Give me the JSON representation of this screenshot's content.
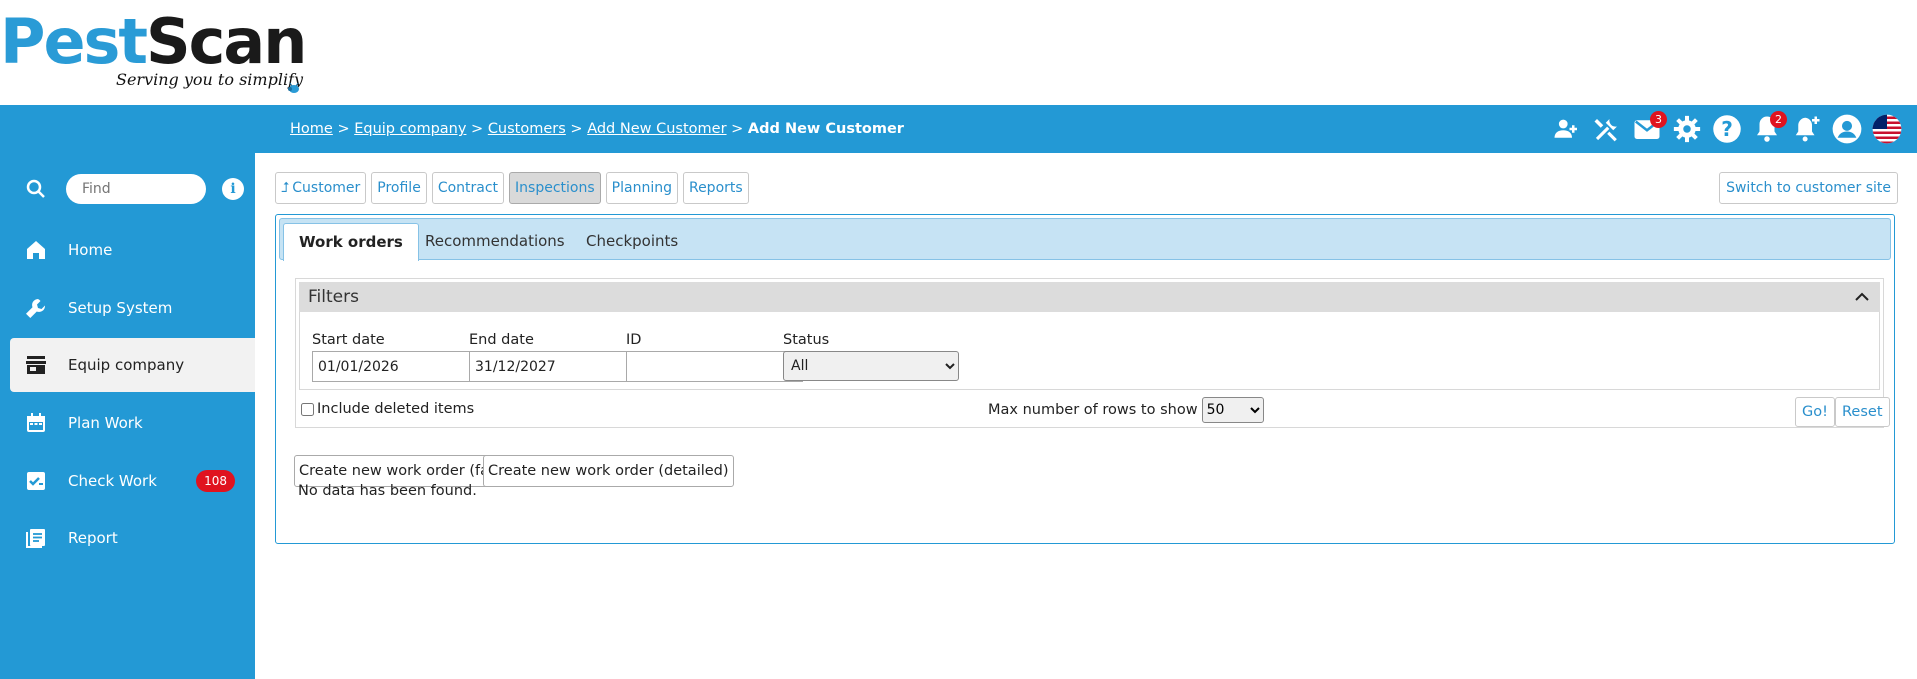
{
  "logo": {
    "pest": "Pest",
    "scan": "Scan",
    "tagline": "Serving you to simplify"
  },
  "breadcrumb": {
    "items": [
      "Home",
      "Equip company",
      "Customers",
      "Add New Customer"
    ],
    "separator": ">",
    "current": "Add New Customer"
  },
  "topbar": {
    "icons": [
      "users-icon",
      "tools-icon",
      "mail-icon",
      "gear-icon",
      "help-icon",
      "bell-icon",
      "bell-add-icon",
      "user-account-icon",
      "uk-flag-icon"
    ],
    "mail_badge": "3",
    "bell_badge": "2"
  },
  "sidebar": {
    "search_placeholder": "Find",
    "info_label": "i",
    "items": [
      {
        "label": "Home",
        "icon": "home-icon"
      },
      {
        "label": "Setup System",
        "icon": "wrench-icon"
      },
      {
        "label": "Equip company",
        "icon": "store-icon"
      },
      {
        "label": "Plan Work",
        "icon": "calendar-icon"
      },
      {
        "label": "Check Work",
        "icon": "checklist-icon",
        "count": "108"
      },
      {
        "label": "Report",
        "icon": "report-icon"
      }
    ],
    "active": "Equip company"
  },
  "subnav": {
    "buttons": [
      "Customer",
      "Profile",
      "Contract",
      "Inspections",
      "Planning",
      "Reports"
    ],
    "active": "Inspections",
    "switch_label": "Switch to customer site"
  },
  "tabs": {
    "items": [
      "Work orders",
      "Recommendations",
      "Checkpoints"
    ],
    "active": "Work orders"
  },
  "filters": {
    "title": "Filters",
    "start_date_label": "Start date",
    "start_date_value": "01/01/2026",
    "end_date_label": "End date",
    "end_date_value": "31/12/2027",
    "id_label": "ID",
    "id_value": "",
    "status_label": "Status",
    "status_value": "All",
    "include_deleted_label": "Include deleted items",
    "max_rows_label": "Max number of rows to show",
    "max_rows_value": "50",
    "go_label": "Go!",
    "reset_label": "Reset"
  },
  "actions": {
    "create_fast": "Create new work order (fast)",
    "create_detailed": "Create new work order (detailed)"
  },
  "results": {
    "empty_message": "No data has been found."
  },
  "colors": {
    "brand_blue": "#2399d5",
    "link_blue": "#2a8fcc",
    "badge_red": "#e0131f",
    "tab_bg": "#c6e3f4"
  }
}
